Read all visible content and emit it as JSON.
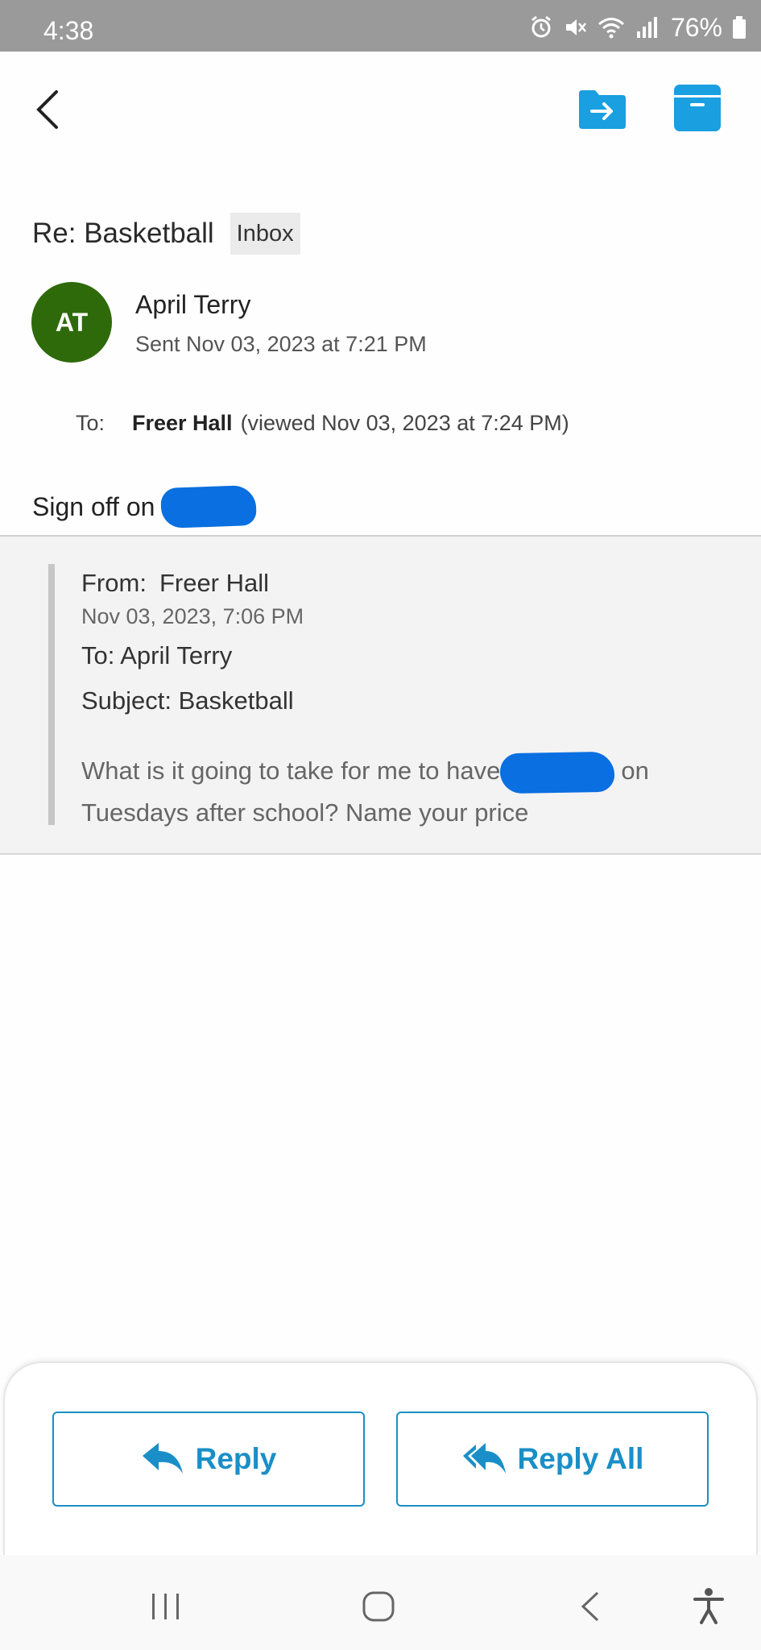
{
  "status_bar": {
    "time": "4:38",
    "battery_percent": "76%",
    "icons": [
      "alarm-icon",
      "mute-icon",
      "wifi-icon",
      "signal-icon",
      "battery-icon"
    ]
  },
  "toolbar": {
    "back_icon": "chevron-left-icon",
    "move_icon": "move-to-folder-icon",
    "archive_icon": "archive-icon"
  },
  "email": {
    "subject": "Re: Basketball",
    "folder": "Inbox",
    "avatar_initials": "AT",
    "sender": "April Terry",
    "sent": "Sent Nov 03, 2023 at 7:21 PM",
    "to_label": "To:",
    "to_name": "Freer Hall",
    "viewed": "(viewed Nov 03, 2023 at 7:24 PM)",
    "body_prefix": "Sign off on"
  },
  "quoted": {
    "from_label": "From:",
    "from_name": "Freer Hall",
    "date": "Nov 03, 2023, 7:06 PM",
    "to": "To: April Terry",
    "subject": "Subject: Basketball",
    "body_part1": "What is it going to take for me to have",
    "body_part2": "on Tuesdays after school? Name your price"
  },
  "actions": {
    "reply": "Reply",
    "reply_all": "Reply All"
  },
  "colors": {
    "accent": "#1a8fc7",
    "toolbar_icon": "#1a9fe0",
    "avatar": "#2e6a0a",
    "redaction": "#0a6fe0"
  }
}
